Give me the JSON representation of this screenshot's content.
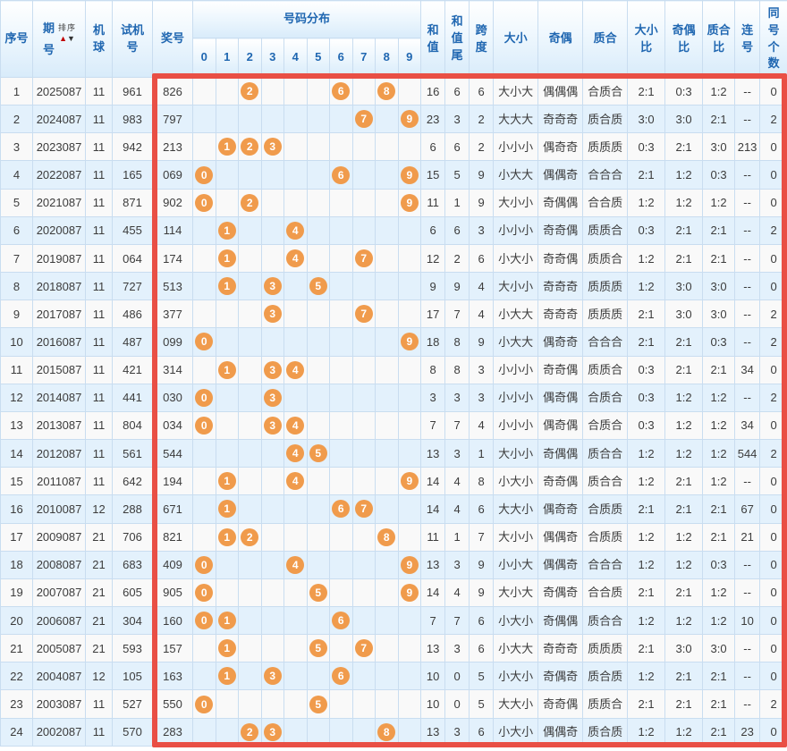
{
  "colors": {
    "highlight_red": "#e94f45",
    "ball_orange": "#f09b4c",
    "header_blue": "#2067b1",
    "stripe_blue": "#e3f1fc",
    "distribution_yellow": "#fcf8e1",
    "grid_line": "#c9ddf0"
  },
  "table": {
    "header": {
      "seq": "序号",
      "period": "期号",
      "sort_label": "排序",
      "sort_up_icon": "▲",
      "sort_down_icon": "▼",
      "machine": "机球",
      "test_number": "试机号",
      "prize_number": "奖号",
      "distribution": "号码分布",
      "digits": [
        "0",
        "1",
        "2",
        "3",
        "4",
        "5",
        "6",
        "7",
        "8",
        "9"
      ],
      "sum": "和值",
      "sum_tail": "和值尾",
      "span": "跨度",
      "size": "大小",
      "parity": "奇偶",
      "prime": "质合",
      "size_ratio": "大小比",
      "parity_ratio": "奇偶比",
      "prime_ratio": "质合比",
      "consecutive": "连号",
      "same_count": "同号个数"
    },
    "rows": [
      {
        "seq": "1",
        "period": "2025087",
        "machine": "11",
        "test": "961",
        "prize": "826",
        "digits": [
          2,
          6,
          8
        ],
        "sum": "16",
        "sum_tail": "6",
        "span": "6",
        "size": "大小大",
        "parity": "偶偶偶",
        "prime": "合质合",
        "size_ratio": "2:1",
        "parity_ratio": "0:3",
        "prime_ratio": "1:2",
        "consecutive": "--",
        "same_count": "0"
      },
      {
        "seq": "2",
        "period": "2024087",
        "machine": "11",
        "test": "983",
        "prize": "797",
        "digits": [
          7,
          9
        ],
        "sum": "23",
        "sum_tail": "3",
        "span": "2",
        "size": "大大大",
        "parity": "奇奇奇",
        "prime": "质合质",
        "size_ratio": "3:0",
        "parity_ratio": "3:0",
        "prime_ratio": "2:1",
        "consecutive": "--",
        "same_count": "2"
      },
      {
        "seq": "3",
        "period": "2023087",
        "machine": "11",
        "test": "942",
        "prize": "213",
        "digits": [
          1,
          2,
          3
        ],
        "sum": "6",
        "sum_tail": "6",
        "span": "2",
        "size": "小小小",
        "parity": "偶奇奇",
        "prime": "质质质",
        "size_ratio": "0:3",
        "parity_ratio": "2:1",
        "prime_ratio": "3:0",
        "consecutive": "213",
        "same_count": "0"
      },
      {
        "seq": "4",
        "period": "2022087",
        "machine": "11",
        "test": "165",
        "prize": "069",
        "digits": [
          0,
          6,
          9
        ],
        "sum": "15",
        "sum_tail": "5",
        "span": "9",
        "size": "小大大",
        "parity": "偶偶奇",
        "prime": "合合合",
        "size_ratio": "2:1",
        "parity_ratio": "1:2",
        "prime_ratio": "0:3",
        "consecutive": "--",
        "same_count": "0"
      },
      {
        "seq": "5",
        "period": "2021087",
        "machine": "11",
        "test": "871",
        "prize": "902",
        "digits": [
          0,
          2,
          9
        ],
        "sum": "11",
        "sum_tail": "1",
        "span": "9",
        "size": "大小小",
        "parity": "奇偶偶",
        "prime": "合合质",
        "size_ratio": "1:2",
        "parity_ratio": "1:2",
        "prime_ratio": "1:2",
        "consecutive": "--",
        "same_count": "0"
      },
      {
        "seq": "6",
        "period": "2020087",
        "machine": "11",
        "test": "455",
        "prize": "114",
        "digits": [
          1,
          4
        ],
        "sum": "6",
        "sum_tail": "6",
        "span": "3",
        "size": "小小小",
        "parity": "奇奇偶",
        "prime": "质质合",
        "size_ratio": "0:3",
        "parity_ratio": "2:1",
        "prime_ratio": "2:1",
        "consecutive": "--",
        "same_count": "2"
      },
      {
        "seq": "7",
        "period": "2019087",
        "machine": "11",
        "test": "064",
        "prize": "174",
        "digits": [
          1,
          4,
          7
        ],
        "sum": "12",
        "sum_tail": "2",
        "span": "6",
        "size": "小大小",
        "parity": "奇奇偶",
        "prime": "质质合",
        "size_ratio": "1:2",
        "parity_ratio": "2:1",
        "prime_ratio": "2:1",
        "consecutive": "--",
        "same_count": "0"
      },
      {
        "seq": "8",
        "period": "2018087",
        "machine": "11",
        "test": "727",
        "prize": "513",
        "digits": [
          1,
          3,
          5
        ],
        "sum": "9",
        "sum_tail": "9",
        "span": "4",
        "size": "大小小",
        "parity": "奇奇奇",
        "prime": "质质质",
        "size_ratio": "1:2",
        "parity_ratio": "3:0",
        "prime_ratio": "3:0",
        "consecutive": "--",
        "same_count": "0"
      },
      {
        "seq": "9",
        "period": "2017087",
        "machine": "11",
        "test": "486",
        "prize": "377",
        "digits": [
          3,
          7
        ],
        "sum": "17",
        "sum_tail": "7",
        "span": "4",
        "size": "小大大",
        "parity": "奇奇奇",
        "prime": "质质质",
        "size_ratio": "2:1",
        "parity_ratio": "3:0",
        "prime_ratio": "3:0",
        "consecutive": "--",
        "same_count": "2"
      },
      {
        "seq": "10",
        "period": "2016087",
        "machine": "11",
        "test": "487",
        "prize": "099",
        "digits": [
          0,
          9
        ],
        "sum": "18",
        "sum_tail": "8",
        "span": "9",
        "size": "小大大",
        "parity": "偶奇奇",
        "prime": "合合合",
        "size_ratio": "2:1",
        "parity_ratio": "2:1",
        "prime_ratio": "0:3",
        "consecutive": "--",
        "same_count": "2"
      },
      {
        "seq": "11",
        "period": "2015087",
        "machine": "11",
        "test": "421",
        "prize": "314",
        "digits": [
          1,
          3,
          4
        ],
        "sum": "8",
        "sum_tail": "8",
        "span": "3",
        "size": "小小小",
        "parity": "奇奇偶",
        "prime": "质质合",
        "size_ratio": "0:3",
        "parity_ratio": "2:1",
        "prime_ratio": "2:1",
        "consecutive": "34",
        "same_count": "0"
      },
      {
        "seq": "12",
        "period": "2014087",
        "machine": "11",
        "test": "441",
        "prize": "030",
        "digits": [
          0,
          3
        ],
        "sum": "3",
        "sum_tail": "3",
        "span": "3",
        "size": "小小小",
        "parity": "偶奇偶",
        "prime": "合质合",
        "size_ratio": "0:3",
        "parity_ratio": "1:2",
        "prime_ratio": "1:2",
        "consecutive": "--",
        "same_count": "2"
      },
      {
        "seq": "13",
        "period": "2013087",
        "machine": "11",
        "test": "804",
        "prize": "034",
        "digits": [
          0,
          3,
          4
        ],
        "sum": "7",
        "sum_tail": "7",
        "span": "4",
        "size": "小小小",
        "parity": "偶奇偶",
        "prime": "合质合",
        "size_ratio": "0:3",
        "parity_ratio": "1:2",
        "prime_ratio": "1:2",
        "consecutive": "34",
        "same_count": "0"
      },
      {
        "seq": "14",
        "period": "2012087",
        "machine": "11",
        "test": "561",
        "prize": "544",
        "digits": [
          4,
          5
        ],
        "sum": "13",
        "sum_tail": "3",
        "span": "1",
        "size": "大小小",
        "parity": "奇偶偶",
        "prime": "质合合",
        "size_ratio": "1:2",
        "parity_ratio": "1:2",
        "prime_ratio": "1:2",
        "consecutive": "544",
        "same_count": "2"
      },
      {
        "seq": "15",
        "period": "2011087",
        "machine": "11",
        "test": "642",
        "prize": "194",
        "digits": [
          1,
          4,
          9
        ],
        "sum": "14",
        "sum_tail": "4",
        "span": "8",
        "size": "小大小",
        "parity": "奇奇偶",
        "prime": "质合合",
        "size_ratio": "1:2",
        "parity_ratio": "2:1",
        "prime_ratio": "1:2",
        "consecutive": "--",
        "same_count": "0"
      },
      {
        "seq": "16",
        "period": "2010087",
        "machine": "12",
        "test": "288",
        "prize": "671",
        "digits": [
          1,
          6,
          7
        ],
        "sum": "14",
        "sum_tail": "4",
        "span": "6",
        "size": "大大小",
        "parity": "偶奇奇",
        "prime": "合质质",
        "size_ratio": "2:1",
        "parity_ratio": "2:1",
        "prime_ratio": "2:1",
        "consecutive": "67",
        "same_count": "0"
      },
      {
        "seq": "17",
        "period": "2009087",
        "machine": "21",
        "test": "706",
        "prize": "821",
        "digits": [
          1,
          2,
          8
        ],
        "sum": "11",
        "sum_tail": "1",
        "span": "7",
        "size": "大小小",
        "parity": "偶偶奇",
        "prime": "合质质",
        "size_ratio": "1:2",
        "parity_ratio": "1:2",
        "prime_ratio": "2:1",
        "consecutive": "21",
        "same_count": "0"
      },
      {
        "seq": "18",
        "period": "2008087",
        "machine": "21",
        "test": "683",
        "prize": "409",
        "digits": [
          0,
          4,
          9
        ],
        "sum": "13",
        "sum_tail": "3",
        "span": "9",
        "size": "小小大",
        "parity": "偶偶奇",
        "prime": "合合合",
        "size_ratio": "1:2",
        "parity_ratio": "1:2",
        "prime_ratio": "0:3",
        "consecutive": "--",
        "same_count": "0"
      },
      {
        "seq": "19",
        "period": "2007087",
        "machine": "21",
        "test": "605",
        "prize": "905",
        "digits": [
          0,
          5,
          9
        ],
        "sum": "14",
        "sum_tail": "4",
        "span": "9",
        "size": "大小大",
        "parity": "奇偶奇",
        "prime": "合合质",
        "size_ratio": "2:1",
        "parity_ratio": "2:1",
        "prime_ratio": "1:2",
        "consecutive": "--",
        "same_count": "0"
      },
      {
        "seq": "20",
        "period": "2006087",
        "machine": "21",
        "test": "304",
        "prize": "160",
        "digits": [
          0,
          1,
          6
        ],
        "sum": "7",
        "sum_tail": "7",
        "span": "6",
        "size": "小大小",
        "parity": "奇偶偶",
        "prime": "质合合",
        "size_ratio": "1:2",
        "parity_ratio": "1:2",
        "prime_ratio": "1:2",
        "consecutive": "10",
        "same_count": "0"
      },
      {
        "seq": "21",
        "period": "2005087",
        "machine": "21",
        "test": "593",
        "prize": "157",
        "digits": [
          1,
          5,
          7
        ],
        "sum": "13",
        "sum_tail": "3",
        "span": "6",
        "size": "小大大",
        "parity": "奇奇奇",
        "prime": "质质质",
        "size_ratio": "2:1",
        "parity_ratio": "3:0",
        "prime_ratio": "3:0",
        "consecutive": "--",
        "same_count": "0"
      },
      {
        "seq": "22",
        "period": "2004087",
        "machine": "12",
        "test": "105",
        "prize": "163",
        "digits": [
          1,
          3,
          6
        ],
        "sum": "10",
        "sum_tail": "0",
        "span": "5",
        "size": "小大小",
        "parity": "奇偶奇",
        "prime": "质合质",
        "size_ratio": "1:2",
        "parity_ratio": "2:1",
        "prime_ratio": "2:1",
        "consecutive": "--",
        "same_count": "0"
      },
      {
        "seq": "23",
        "period": "2003087",
        "machine": "11",
        "test": "527",
        "prize": "550",
        "digits": [
          0,
          5
        ],
        "sum": "10",
        "sum_tail": "0",
        "span": "5",
        "size": "大大小",
        "parity": "奇奇偶",
        "prime": "质质合",
        "size_ratio": "2:1",
        "parity_ratio": "2:1",
        "prime_ratio": "2:1",
        "consecutive": "--",
        "same_count": "2"
      },
      {
        "seq": "24",
        "period": "2002087",
        "machine": "11",
        "test": "570",
        "prize": "283",
        "digits": [
          2,
          3,
          8
        ],
        "sum": "13",
        "sum_tail": "3",
        "span": "6",
        "size": "小大小",
        "parity": "偶偶奇",
        "prime": "质合质",
        "size_ratio": "1:2",
        "parity_ratio": "1:2",
        "prime_ratio": "2:1",
        "consecutive": "23",
        "same_count": "0"
      }
    ]
  }
}
